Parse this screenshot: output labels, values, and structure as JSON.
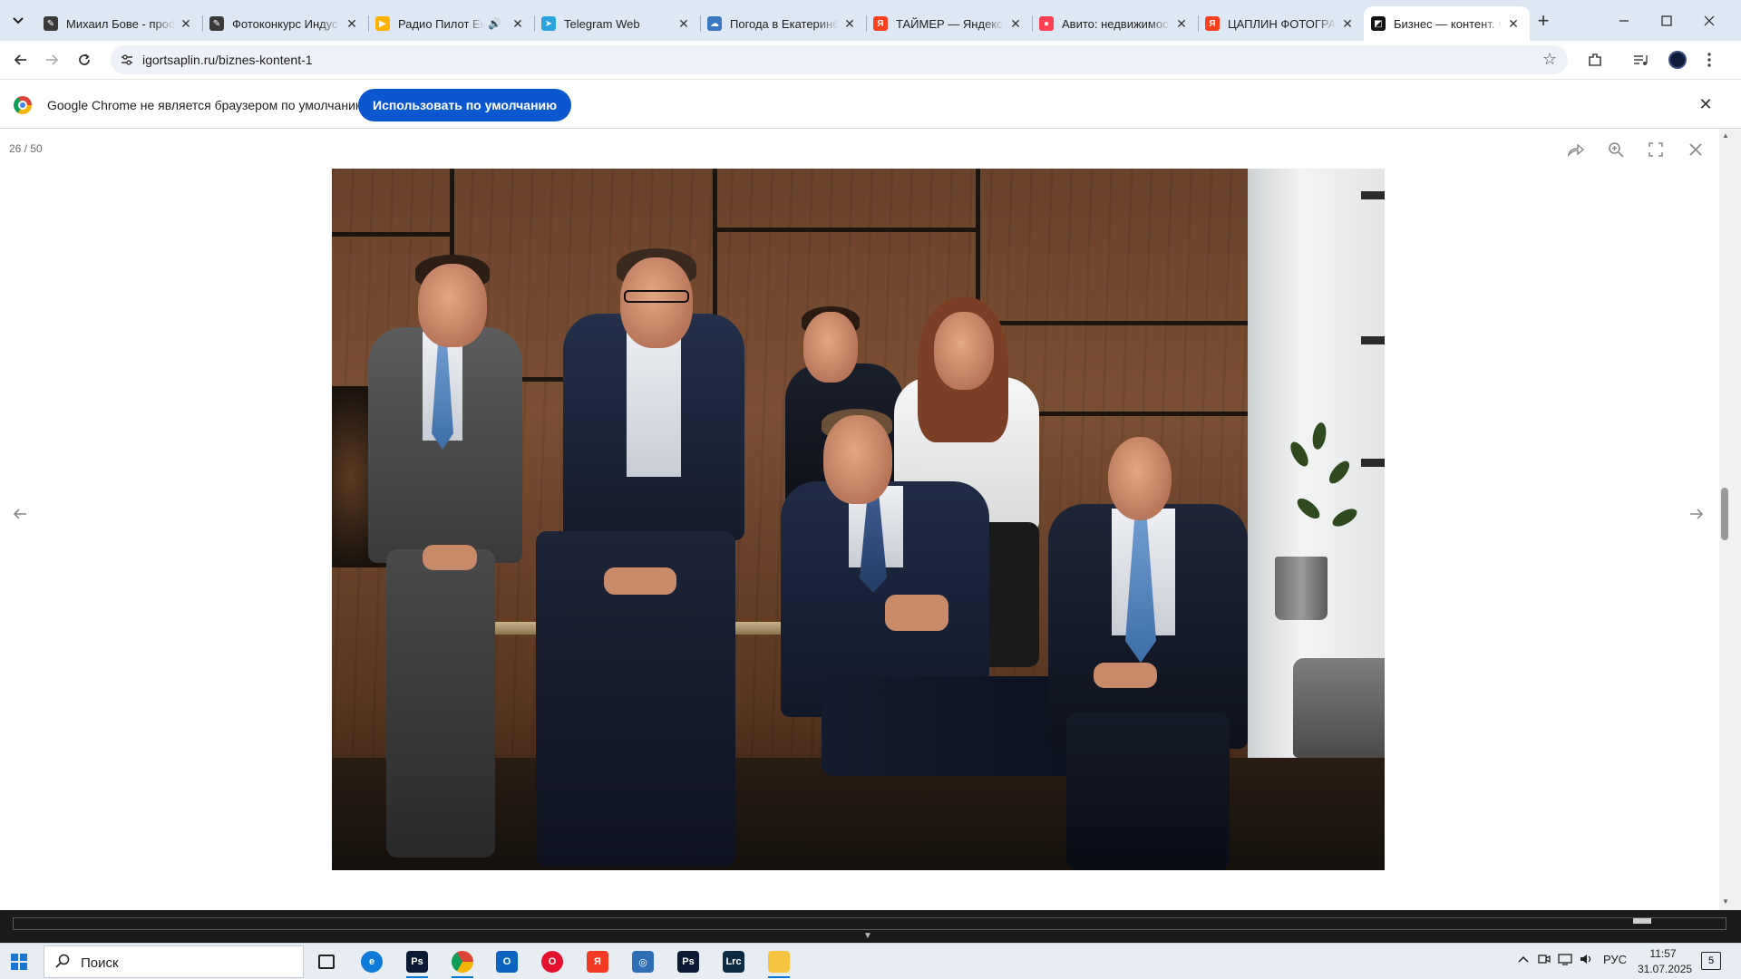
{
  "browser": {
    "tabs": [
      {
        "title": "Михаил Бове - проф",
        "favicon_color": "#3a3a3a",
        "favicon_glyph": "✎",
        "active": false
      },
      {
        "title": "Фотоконкурс Индус",
        "favicon_color": "#3a3a3a",
        "favicon_glyph": "✎",
        "active": false
      },
      {
        "title": "Радио Пилот Ека",
        "favicon_color": "#ffb300",
        "favicon_glyph": "▶",
        "active": false,
        "audio": true
      },
      {
        "title": "Telegram Web",
        "favicon_color": "#2aa3df",
        "favicon_glyph": "➤",
        "active": false
      },
      {
        "title": "Погода в Екатеринб",
        "favicon_color": "#3b78c4",
        "favicon_glyph": "☁",
        "active": false
      },
      {
        "title": "ТАЙМЕР — Яндекс",
        "favicon_color": "#fc3f1d",
        "favicon_glyph": "Я",
        "active": false
      },
      {
        "title": "Авито: недвижимос",
        "favicon_color": "#ff4053",
        "favicon_glyph": "●",
        "active": false
      },
      {
        "title": "ЦАПЛИН ФОТОГРАФ",
        "favicon_color": "#fc3f1d",
        "favicon_glyph": "Я",
        "active": false
      },
      {
        "title": "Бизнес — контент. Ф",
        "favicon_color": "#111111",
        "favicon_glyph": "◩",
        "active": true
      }
    ],
    "url": "igortsaplin.ru/biznes-kontent-1"
  },
  "infobar": {
    "message": "Google Chrome не является браузером по умолчанию.",
    "button_label": "Использовать по умолчанию"
  },
  "viewer": {
    "counter": "26 / 50"
  },
  "taskbar": {
    "search_placeholder": "Поиск",
    "apps": [
      {
        "name": "task-view",
        "label": "",
        "color": "transparent"
      },
      {
        "name": "edge",
        "label": "e",
        "color": "#0f7bd8"
      },
      {
        "name": "photoshop",
        "label": "Ps",
        "color": "#0a1a33"
      },
      {
        "name": "chrome",
        "label": "",
        "color": "#ffffff"
      },
      {
        "name": "outlook",
        "label": "O",
        "color": "#0a64c0"
      },
      {
        "name": "opera",
        "label": "O",
        "color": "#e3122c"
      },
      {
        "name": "yandex-browser",
        "label": "Я",
        "color": "#f33a22"
      },
      {
        "name": "screen-capture",
        "label": "◎",
        "color": "#2f6db5"
      },
      {
        "name": "photoshop-2",
        "label": "Ps",
        "color": "#0a1a33"
      },
      {
        "name": "lightroom-classic",
        "label": "Lrc",
        "color": "#0b2a43"
      },
      {
        "name": "file-explorer",
        "label": "",
        "color": "#f5c542"
      }
    ],
    "language": "РУС",
    "time": "11:57",
    "date": "31.07.2025",
    "notifications": "5"
  }
}
